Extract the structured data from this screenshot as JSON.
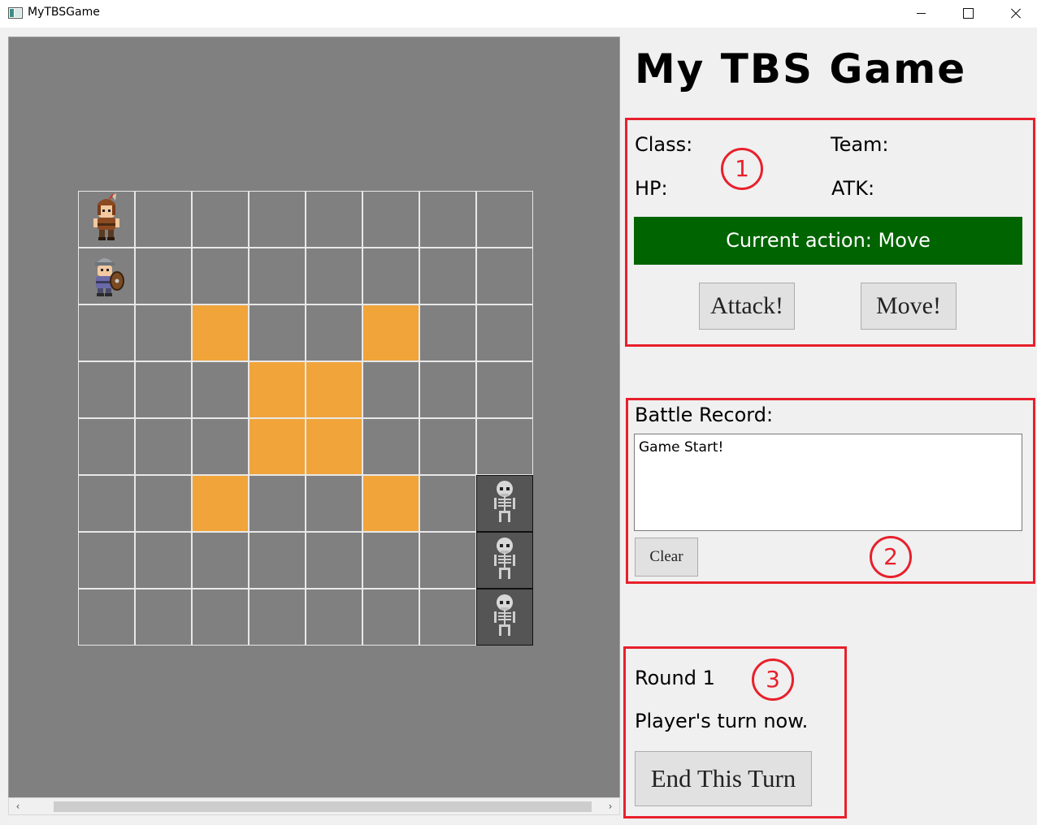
{
  "window": {
    "title": "MyTBSGame",
    "controls": [
      "minimize-icon",
      "maximize-icon",
      "close-icon"
    ]
  },
  "header": {
    "game_title": "My TBS Game"
  },
  "colors": {
    "map_background": "#808080",
    "highlight_tile": "#f0a43a",
    "enemy_tile": "#555555",
    "action_bar": "#006400",
    "annotation_red": "#e8202c"
  },
  "map": {
    "rows": 8,
    "cols": 8,
    "highlighted_cells": [
      [
        2,
        2
      ],
      [
        2,
        5
      ],
      [
        3,
        3
      ],
      [
        3,
        4
      ],
      [
        4,
        3
      ],
      [
        4,
        4
      ],
      [
        5,
        2
      ],
      [
        5,
        5
      ]
    ],
    "units": [
      {
        "row": 0,
        "col": 0,
        "kind": "viking-warrior",
        "icon": "viking-warrior-icon",
        "team": "player"
      },
      {
        "row": 1,
        "col": 0,
        "kind": "shield-knight",
        "icon": "knight-icon",
        "team": "player"
      },
      {
        "row": 5,
        "col": 7,
        "kind": "skeleton",
        "icon": "skeleton-icon",
        "team": "enemy"
      },
      {
        "row": 6,
        "col": 7,
        "kind": "skeleton",
        "icon": "skeleton-icon",
        "team": "enemy"
      },
      {
        "row": 7,
        "col": 7,
        "kind": "skeleton",
        "icon": "skeleton-icon",
        "team": "enemy"
      }
    ]
  },
  "info_panel": {
    "class_label": "Class:",
    "team_label": "Team:",
    "hp_label": "HP:",
    "atk_label": "ATK:",
    "current_action": "Current action: Move",
    "attack_button": "Attack!",
    "move_button": "Move!",
    "annotation": "1"
  },
  "record_panel": {
    "label": "Battle Record:",
    "log_text": "Game Start!",
    "clear_button": "Clear",
    "annotation": "2"
  },
  "round_panel": {
    "round_text": "Round 1",
    "turn_text": "Player's turn now.",
    "end_turn_button": "End This Turn",
    "annotation": "3"
  },
  "scrollbar": {
    "left_arrow": "‹",
    "right_arrow": "›"
  }
}
